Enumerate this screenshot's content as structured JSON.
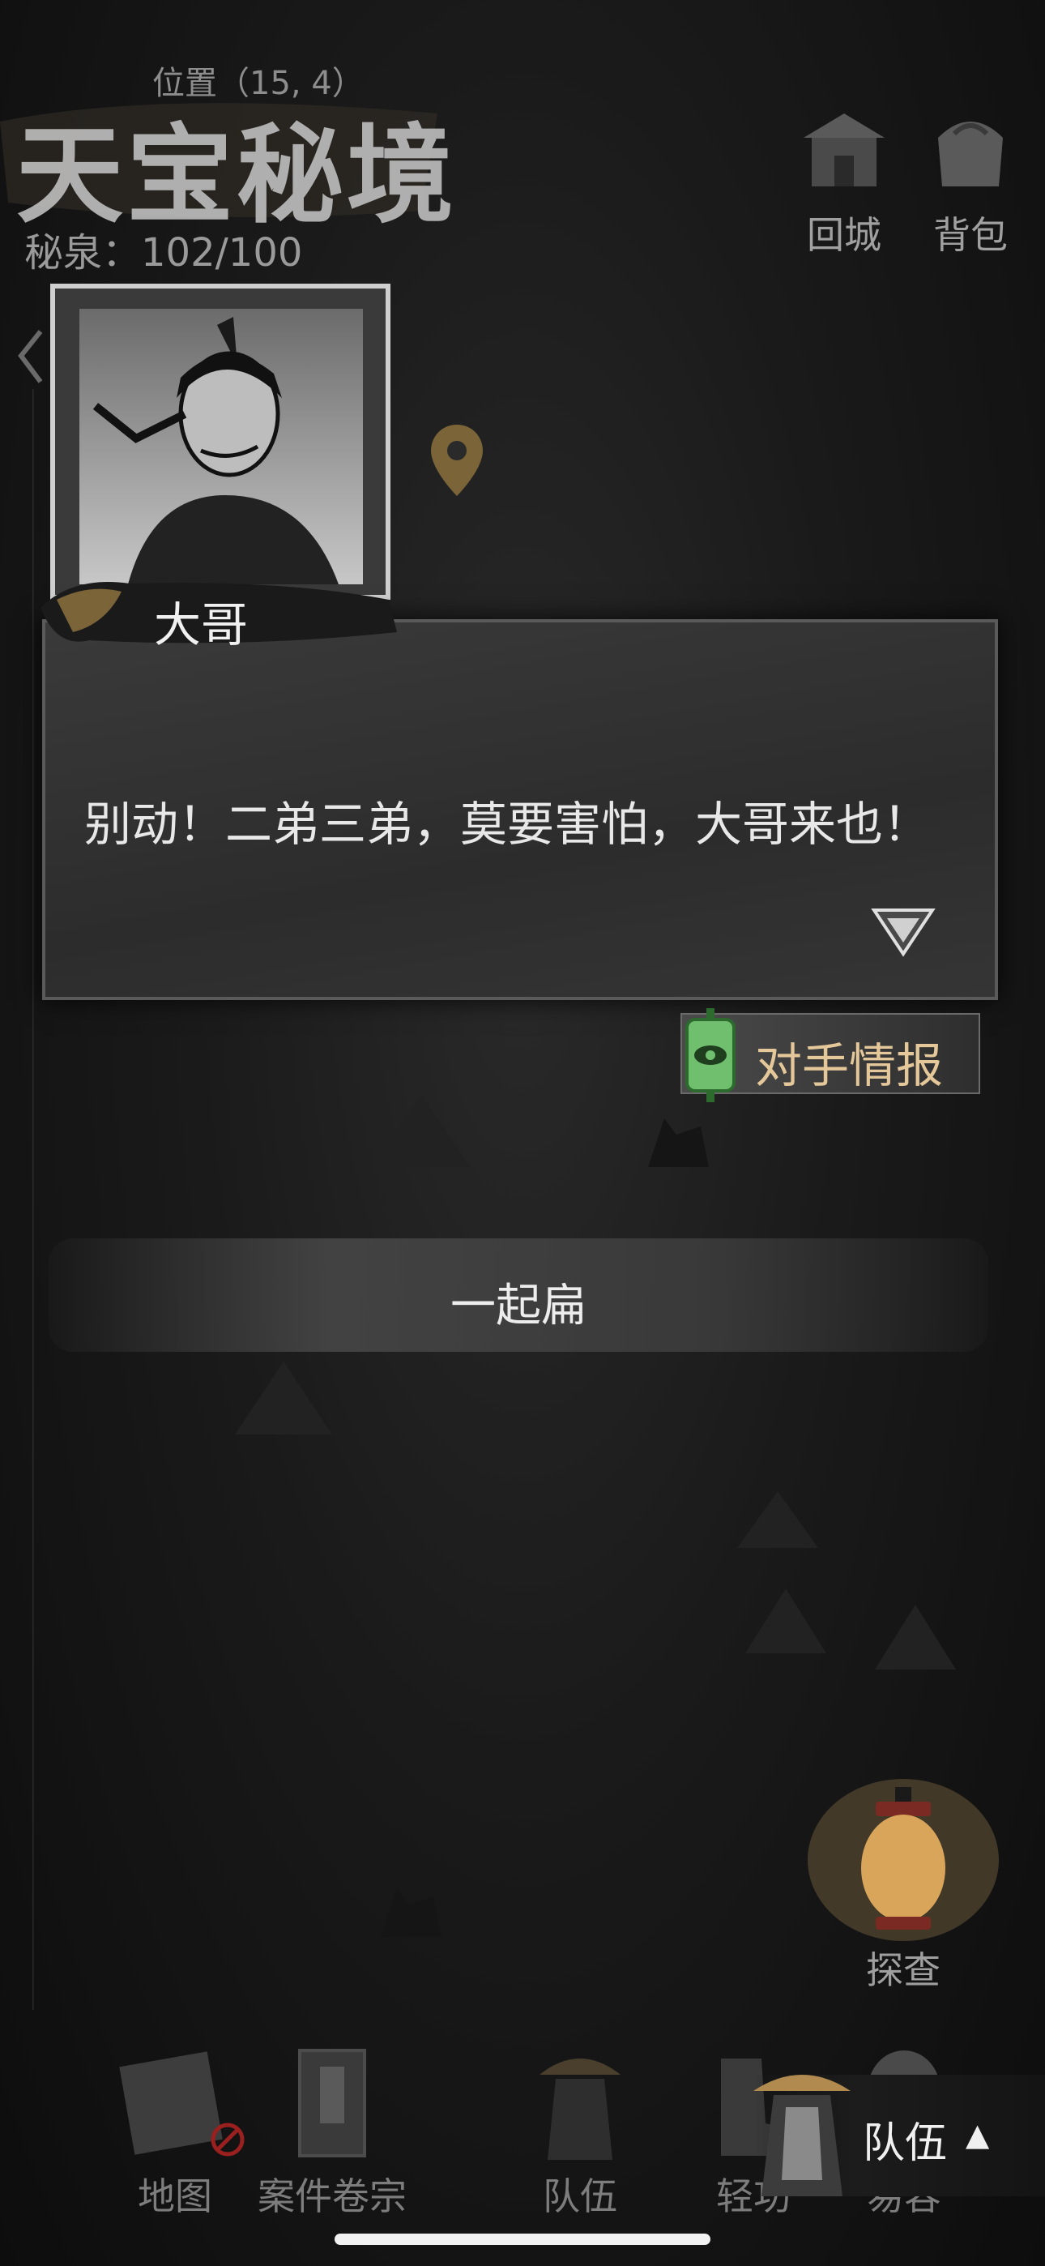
{
  "header": {
    "location": "位置（15, 4）",
    "title": "天宝秘境",
    "secret_spring": "秘泉：102/100",
    "return_city": "回城",
    "backpack": "背包"
  },
  "dialogue": {
    "speaker": "大哥",
    "text": "别动！二弟三弟，莫要害怕，大哥来也！"
  },
  "intel_button": "对手情报",
  "choice": "一起扁",
  "explore": "探查",
  "bottom_nav": {
    "map": "地图",
    "case_files": "案件卷宗",
    "team": "队伍",
    "qinggong": "轻功",
    "easy_face": "易容"
  },
  "team_panel": {
    "label": "队伍",
    "arrow": "▲"
  }
}
